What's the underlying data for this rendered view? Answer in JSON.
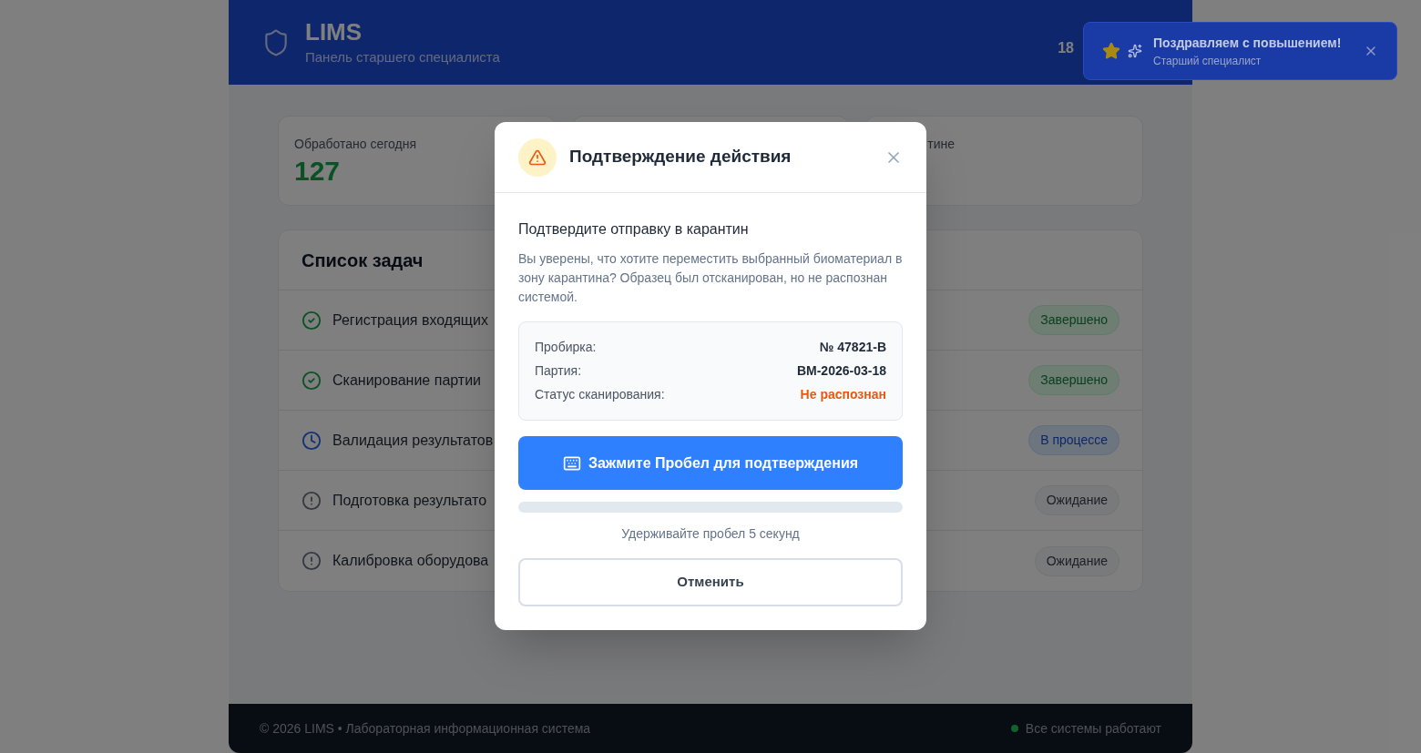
{
  "header": {
    "title": "LIMS",
    "subtitle": "Панель старшего специалиста",
    "date": "18"
  },
  "toast": {
    "title": "Поздравляем с повышением!",
    "subtitle": "Старший специалист"
  },
  "stats": [
    {
      "kind": "metric",
      "label": "Обработано сегодня",
      "value": "127"
    },
    {
      "kind": "blank"
    },
    {
      "kind": "metric",
      "label": "тине"
    }
  ],
  "tasks": {
    "title": "Список задач",
    "rows": [
      {
        "name": "Регистрация входящих",
        "status": "Завершено",
        "kind": "done"
      },
      {
        "name": "Сканирование партии",
        "status": "Завершено",
        "kind": "done"
      },
      {
        "name": "Валидация результатов",
        "status": "В процессе",
        "kind": "progress"
      },
      {
        "name": "Подготовка результато",
        "status": "Ожидание",
        "kind": "pending"
      },
      {
        "name": "Калибровка оборудова",
        "status": "Ожидание",
        "kind": "pending"
      }
    ]
  },
  "dialog": {
    "title": "Подтверждение действия",
    "subtitle": "Подтвердите отправку в карантин",
    "message": "Вы уверены, что хотите переместить выбранный биоматериал в зону карантина? Образец был отсканирован, но не распознан системой.",
    "details": [
      {
        "label": "Пробирка:",
        "value": "№ 47821-B",
        "kind": "normal"
      },
      {
        "label": "Партия:",
        "value": "BM-2026-03-18",
        "kind": "normal"
      },
      {
        "label": "Статус сканирования:",
        "value": "Не распознан",
        "kind": "warning"
      }
    ],
    "confirm": "Зажмите Пробел для подтверждения",
    "hint": "Удерживайте пробел 5 секунд",
    "cancel": "Отменить"
  },
  "footer": {
    "copyright": "© 2026 LIMS • Лабораторная информационная система",
    "status": "Все системы работают",
    "online": true
  }
}
